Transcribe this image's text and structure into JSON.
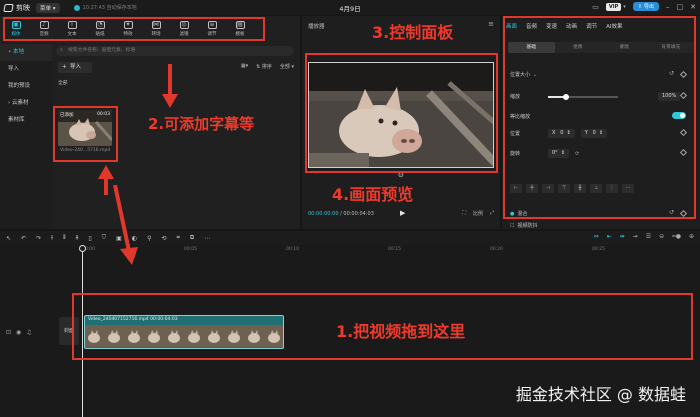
{
  "titlebar": {
    "app_name": "剪映",
    "menu_label": "菜单",
    "autosave": "10:27:43 自动保存本地",
    "project_title": "4月9日",
    "vip_label": "VIP",
    "share_label": "导出"
  },
  "toolbar": {
    "tools": [
      {
        "label": "媒体",
        "icon": "media-icon",
        "glyph": "▣"
      },
      {
        "label": "音频",
        "icon": "audio-icon",
        "glyph": "♪"
      },
      {
        "label": "文本",
        "icon": "text-icon",
        "glyph": "T"
      },
      {
        "label": "贴纸",
        "icon": "sticker-icon",
        "glyph": "◔"
      },
      {
        "label": "特效",
        "icon": "effects-icon",
        "glyph": "✦"
      },
      {
        "label": "转场",
        "icon": "transition-icon",
        "glyph": "⋈"
      },
      {
        "label": "滤镜",
        "icon": "filter-icon",
        "glyph": "◎"
      },
      {
        "label": "调节",
        "icon": "adjust-icon",
        "glyph": "≡"
      },
      {
        "label": "模板",
        "icon": "template-icon",
        "glyph": "▤"
      }
    ]
  },
  "sidebar": {
    "items": [
      {
        "label": "• 本地"
      },
      {
        "label": "导入"
      },
      {
        "label": "我的预设"
      },
      {
        "label": "› 云素材"
      },
      {
        "label": "素材库"
      }
    ]
  },
  "media": {
    "search_placeholder": "搜索文件名称、画面元素、标语",
    "import_label": "导入",
    "sort_label": "排序",
    "filter_label": "全部",
    "all_label": "全部",
    "thumb_added": "已添加",
    "thumb_duration": "00:03",
    "thumb_name": "Video-240...5716.mp4"
  },
  "player": {
    "title": "播放器",
    "time_current": "00:00:00:00",
    "time_total": "/ 00:00:04:03",
    "ratio_label": "比例"
  },
  "props": {
    "tabs": [
      {
        "label": "画面"
      },
      {
        "label": "音频"
      },
      {
        "label": "变速"
      },
      {
        "label": "动画"
      },
      {
        "label": "调节"
      },
      {
        "label": "AI效果"
      }
    ],
    "subtabs": [
      {
        "label": "基础"
      },
      {
        "label": "抠像"
      },
      {
        "label": "蒙版"
      },
      {
        "label": "背景填充"
      }
    ],
    "section_position": "位置大小",
    "scale_label": "缩放",
    "scale_value": "100%",
    "scale_fraction": 0.25,
    "uniform_label": "等比缩放",
    "position_label": "位置",
    "pos_x_label": "X",
    "pos_x_value": "0",
    "pos_y_label": "Y",
    "pos_y_value": "0",
    "rotate_label": "旋转",
    "rotate_value": "0°",
    "blend_label": "混合",
    "stabilize_label": "视频防抖"
  },
  "timeline": {
    "ruler_ticks": [
      "00:00",
      "00:05",
      "00:10",
      "00:15",
      "00:20",
      "00:25"
    ],
    "cover_label": "封面",
    "clip_label": "Video_240407152716.mp4   00:00:04:03"
  },
  "annotations": {
    "a1": "1.把视频拖到这里",
    "a2": "2.可添加字幕等",
    "a3": "3.控制面板",
    "a4": "4.画面预览"
  },
  "watermark": "掘金技术社区 @ 数据蛙"
}
